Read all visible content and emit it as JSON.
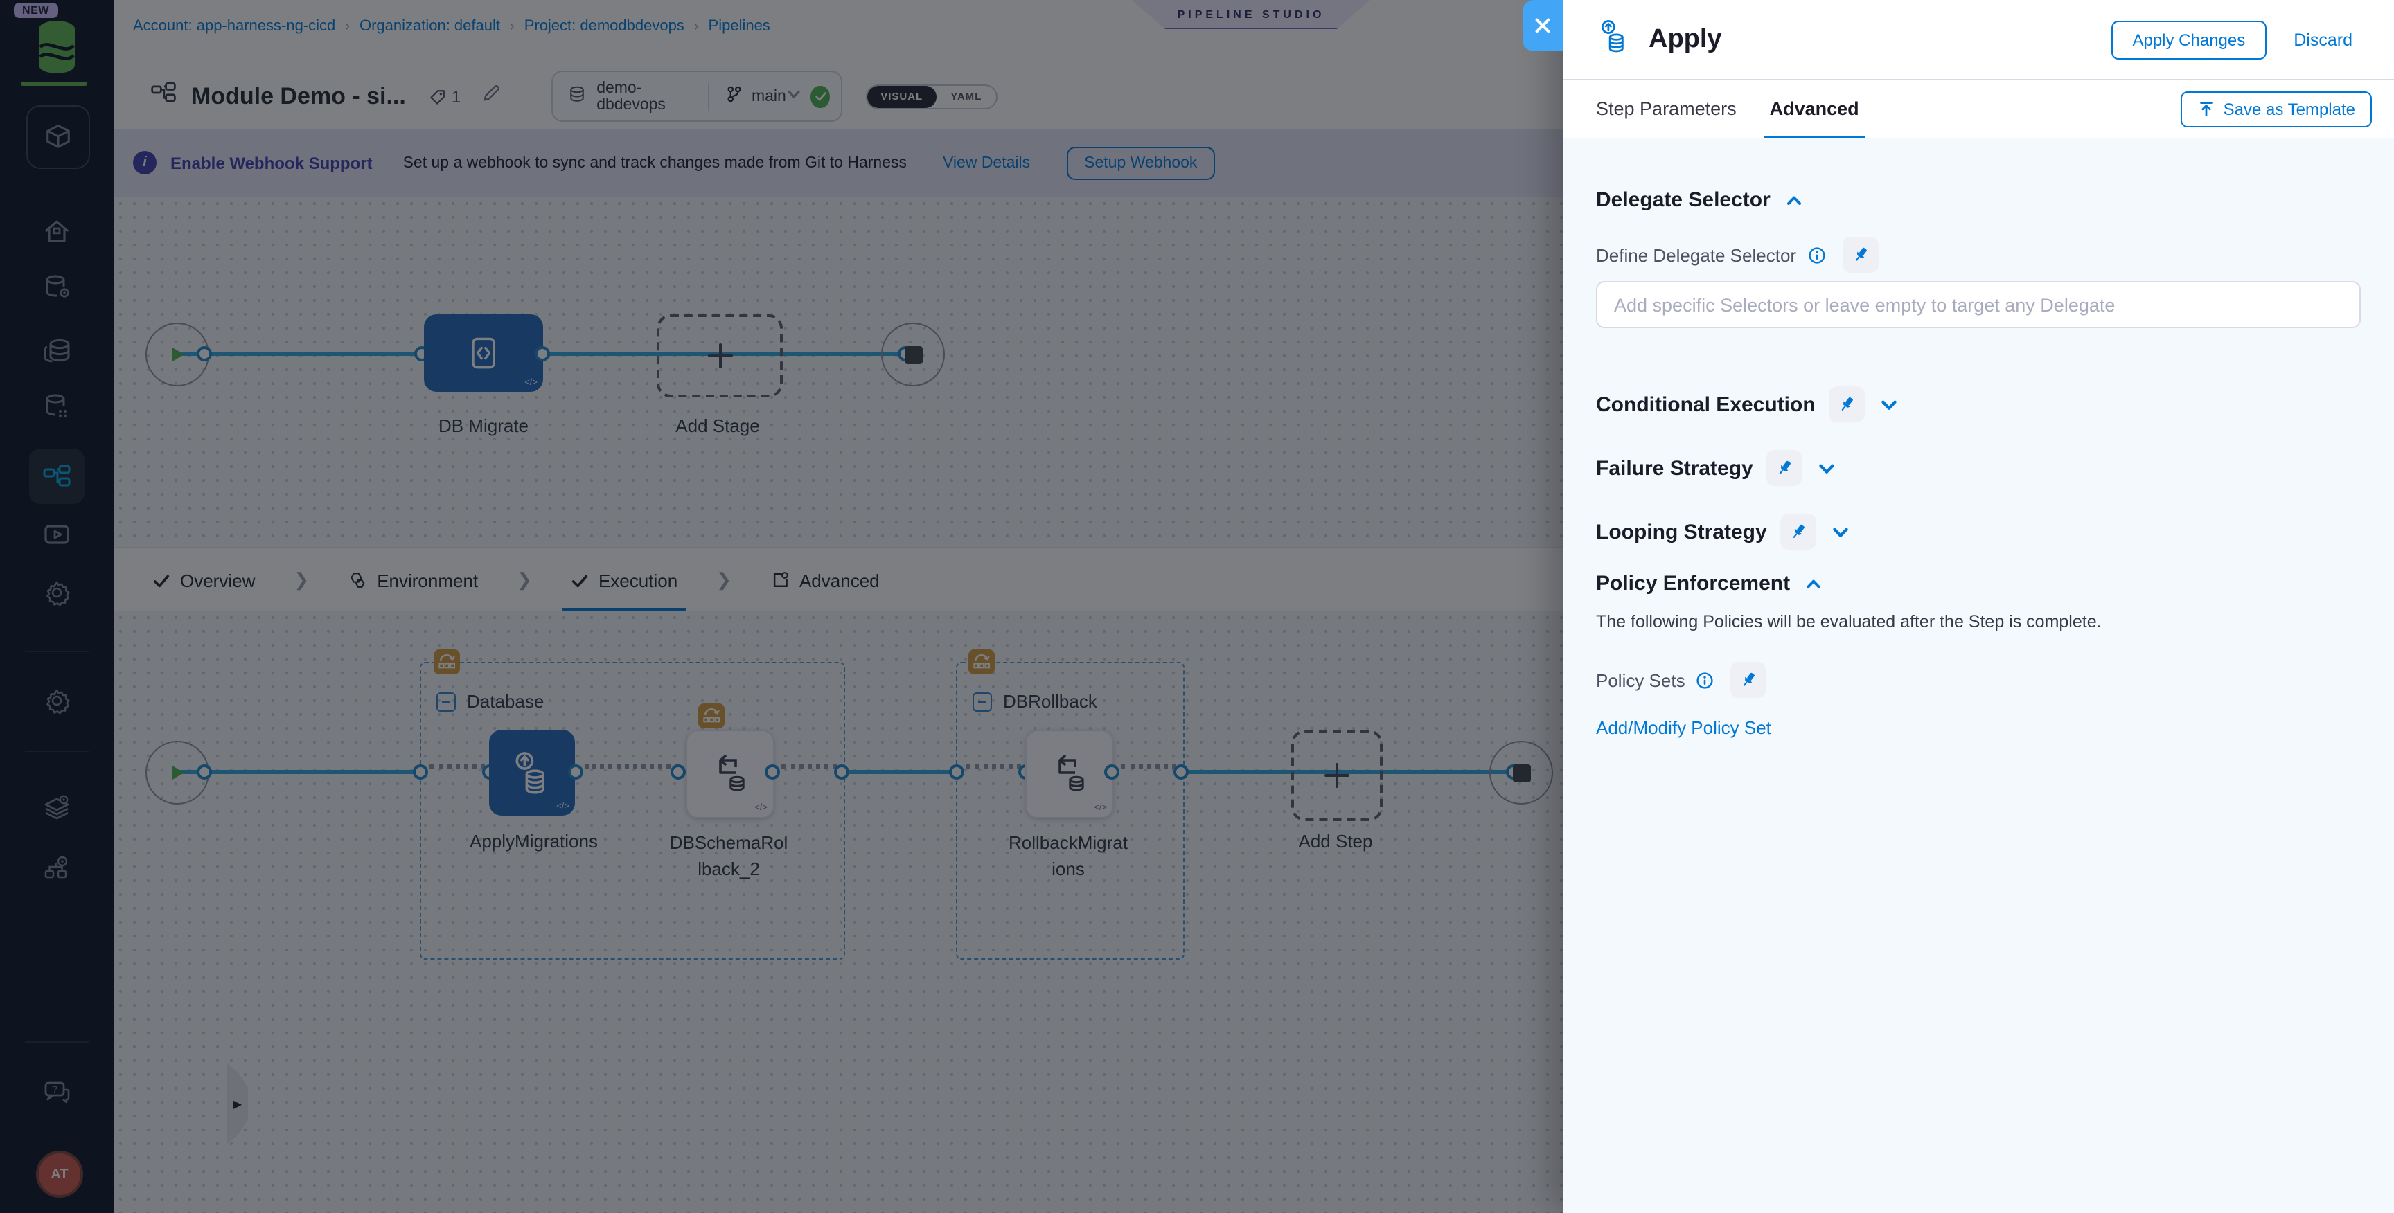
{
  "breadcrumb": {
    "items": [
      "Account: app-harness-ng-cicd",
      "Organization: default",
      "Project: demodbdevops",
      "Pipelines"
    ],
    "separator": "›"
  },
  "studio_badge": "PIPELINE STUDIO",
  "header": {
    "title": "Module Demo - si...",
    "tag_count": "1",
    "repo": "demo-dbdevops",
    "branch": "main",
    "visual_label": "VISUAL",
    "yaml_label": "YAML"
  },
  "banner": {
    "title": "Enable Webhook Support",
    "message": "Set up a webhook to sync and track changes made from Git to Harness",
    "view_details": "View Details",
    "setup_webhook": "Setup Webhook"
  },
  "stage_graph": {
    "stage_label": "DB Migrate",
    "add_stage_label": "Add Stage",
    "code_badge": "</>"
  },
  "nav_tabs": {
    "overview": "Overview",
    "environment": "Environment",
    "execution": "Execution",
    "advanced": "Advanced"
  },
  "execution_graph": {
    "group1_label": "Database",
    "step1_label": "ApplyMigrations",
    "step2_label": "DBSchemaRollback_2",
    "group2_label": "DBRollback",
    "step3_label": "RollbackMigrations",
    "add_step_label": "Add Step",
    "code_badge": "</>"
  },
  "sidebar": {
    "new_badge": "NEW",
    "avatar_initials": "AT"
  },
  "drawer": {
    "title": "Apply",
    "apply_changes": "Apply Changes",
    "discard": "Discard",
    "tab_step_parameters": "Step Parameters",
    "tab_advanced": "Advanced",
    "save_as_template": "Save as Template",
    "delegate": {
      "heading": "Delegate Selector",
      "label": "Define Delegate Selector",
      "placeholder": "Add specific Selectors or leave empty to target any Delegate"
    },
    "conditional_heading": "Conditional Execution",
    "failure_heading": "Failure Strategy",
    "looping_heading": "Looping Strategy",
    "policy": {
      "heading": "Policy Enforcement",
      "description": "The following Policies will be evaluated after the Step is complete.",
      "label": "Policy Sets",
      "link": "Add/Modify Policy Set"
    }
  },
  "colors": {
    "accent": "#0278d5",
    "close_blue": "#42a5f5",
    "success_green": "#4caf50",
    "loop_badge_orange": "#d29a3c",
    "node_blue": "#2368b8"
  }
}
